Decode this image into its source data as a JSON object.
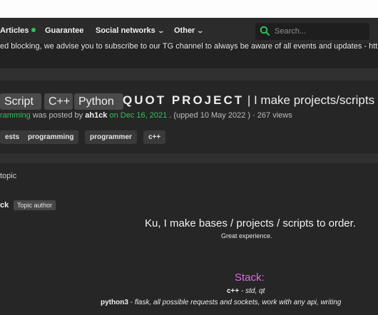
{
  "nav": {
    "items": [
      {
        "label": "Articles",
        "has_dot": true
      },
      {
        "label": "Guarantee"
      },
      {
        "label": "Social networks",
        "has_chevron": true
      },
      {
        "label": "Other",
        "has_chevron": true
      }
    ],
    "search_placeholder": "Search..."
  },
  "notice": "ed blocking, we advise you to subscribe to our TG channel to always be aware of all events and updates - https://t",
  "thread": {
    "prefixes": [
      "Script",
      "C++",
      "Python"
    ],
    "title_emphasis": "QUOT PROJECT",
    "title_rest": " | I make projects/scripts",
    "meta": {
      "section": "ramming",
      "posted_by_text": " was posted by ",
      "author": "ah1ck",
      "date": " on Dec 16, 2021",
      "upped": " . (upped 10 May 2022 )",
      "views": "  · 267 views"
    },
    "tags": [
      "ests",
      "programming",
      "programmer",
      "c++"
    ]
  },
  "topic_label": "topic",
  "post": {
    "author": "ck",
    "author_badge": "Topic author",
    "heading": "Ku, I make bases / projects / scripts to order.",
    "subheading": "Great experience.",
    "stack_title": "Stack:",
    "stack_lines": [
      {
        "lang": "c++",
        "desc": " - std, qt"
      },
      {
        "lang": "python3",
        "desc": " - flask, all possible requests and sockets, work with any api, writing"
      }
    ]
  },
  "colors": {
    "accent_green": "#2fc05a",
    "stack_magenta": "#d96fdc",
    "background": "#262626"
  }
}
